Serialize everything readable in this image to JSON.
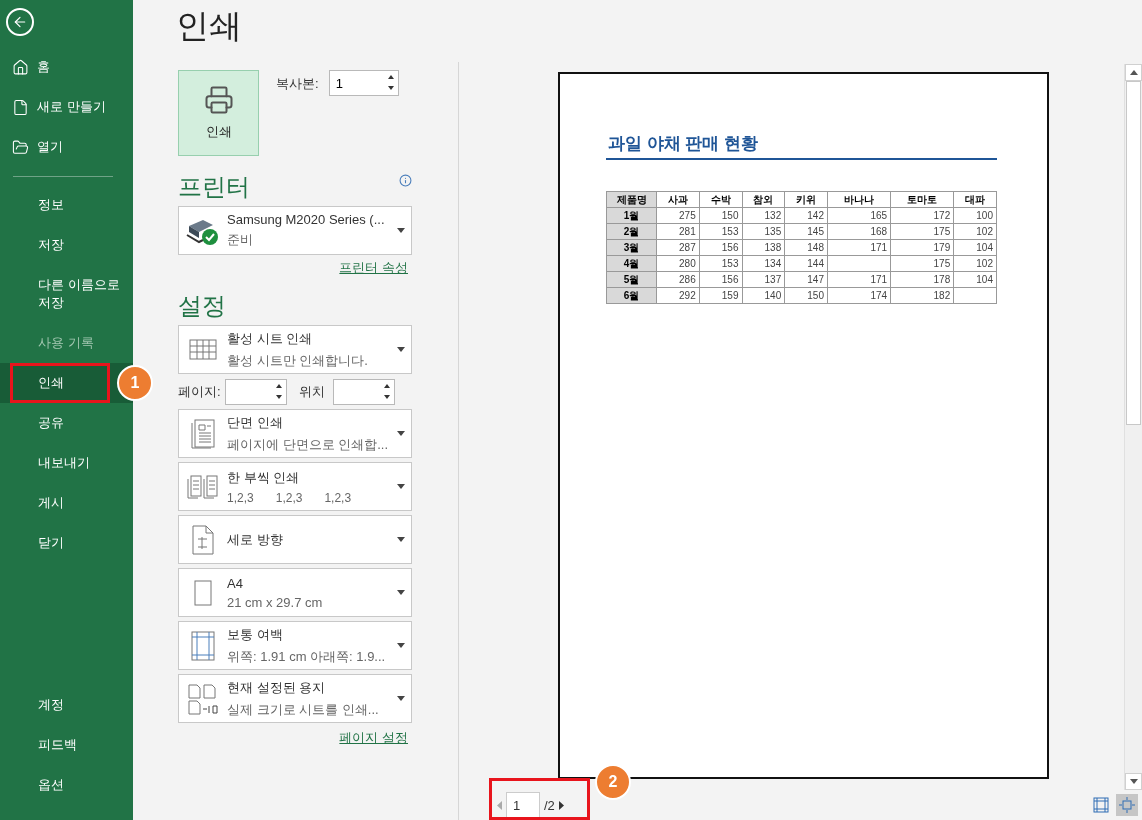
{
  "sidebar": {
    "top": [
      {
        "label": "홈",
        "selected": false,
        "disabled": false
      },
      {
        "label": "새로 만들기",
        "selected": false,
        "disabled": false
      },
      {
        "label": "열기",
        "selected": false,
        "disabled": false
      }
    ],
    "middle": [
      {
        "label": "정보",
        "selected": false,
        "disabled": false
      },
      {
        "label": "저장",
        "selected": false,
        "disabled": false
      },
      {
        "label": "다른 이름으로 저장",
        "selected": false,
        "disabled": false
      },
      {
        "label": "사용 기록",
        "selected": false,
        "disabled": true
      },
      {
        "label": "인쇄",
        "selected": true,
        "disabled": false,
        "highlighted": true,
        "callout": "1"
      },
      {
        "label": "공유",
        "selected": false,
        "disabled": false
      },
      {
        "label": "내보내기",
        "selected": false,
        "disabled": false
      },
      {
        "label": "게시",
        "selected": false,
        "disabled": false
      },
      {
        "label": "닫기",
        "selected": false,
        "disabled": false
      }
    ],
    "bottom": [
      {
        "label": "계정",
        "selected": false,
        "disabled": false
      },
      {
        "label": "피드백",
        "selected": false,
        "disabled": false
      },
      {
        "label": "옵션",
        "selected": false,
        "disabled": false
      }
    ]
  },
  "title": "인쇄",
  "print_button": {
    "label": "인쇄"
  },
  "copies": {
    "label": "복사본:",
    "value": "1"
  },
  "printer": {
    "heading": "프린터",
    "name": "Samsung M2020 Series (...",
    "status": "준비",
    "link": "프린터 속성"
  },
  "settings": {
    "heading": "설정",
    "items": [
      {
        "kind": "dropdown",
        "title": "활성 시트 인쇄",
        "subtitle": "활성 시트만 인쇄합니다."
      },
      {
        "kind": "range",
        "from_label": "페이지:",
        "to_label": "위치"
      },
      {
        "kind": "dropdown",
        "title": "단면 인쇄",
        "subtitle": "페이지에 단면으로 인쇄합..."
      },
      {
        "kind": "dropdown",
        "title": "한 부씩 인쇄",
        "subtitle": [
          "1,2,3",
          "1,2,3",
          "1,2,3"
        ]
      },
      {
        "kind": "dropdown",
        "title": "세로 방향"
      },
      {
        "kind": "dropdown",
        "title": "A4",
        "subtitle": "21 cm x 29.7 cm"
      },
      {
        "kind": "dropdown",
        "title": "보통 여백",
        "subtitle": "위쪽: 1.91 cm 아래쪽: 1.9..."
      },
      {
        "kind": "dropdown",
        "title": "현재 설정된 용지",
        "subtitle": "실제 크기로 시트를 인쇄..."
      }
    ],
    "link": "페이지 설정"
  },
  "preview": {
    "title": "과일 야채 판매 현황",
    "table": {
      "columns": [
        "제품명",
        "사과",
        "수박",
        "참외",
        "키위",
        "바나나",
        "토마토",
        "대파"
      ],
      "rows": [
        [
          "1월",
          "275",
          "150",
          "132",
          "142",
          "165",
          "172",
          "100"
        ],
        [
          "2월",
          "281",
          "153",
          "135",
          "145",
          "168",
          "175",
          "102"
        ],
        [
          "3월",
          "287",
          "156",
          "138",
          "148",
          "171",
          "179",
          "104"
        ],
        [
          "4월",
          "280",
          "153",
          "134",
          "144",
          null,
          "175",
          "102"
        ],
        [
          "5월",
          "286",
          "156",
          "137",
          "147",
          "171",
          "178",
          "104"
        ],
        [
          "6월",
          "292",
          "159",
          "140",
          "150",
          "174",
          "182",
          null
        ]
      ]
    }
  },
  "page_nav": {
    "current": "1",
    "total": "/2",
    "highlighted": true,
    "callout": "2"
  },
  "view_buttons": [
    {
      "selected": false
    },
    {
      "selected": true
    }
  ]
}
